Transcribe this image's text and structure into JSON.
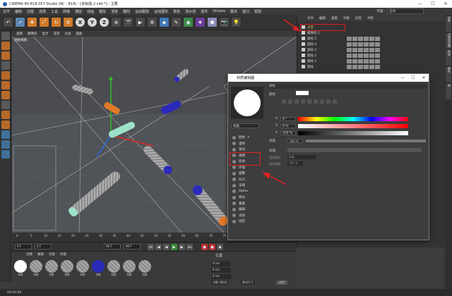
{
  "window": {
    "title": "CINEMA 4D R18.057 Studio (RC - R18) - [未标题 2.c4d *] - 主要",
    "min": "—",
    "max": "☐",
    "close": "✕"
  },
  "menubar": {
    "items": [
      "文件",
      "编辑",
      "创建",
      "选择",
      "工具",
      "网格",
      "捕捉",
      "动画",
      "模拟",
      "渲染",
      "雕刻",
      "运动跟踪",
      "运动图形",
      "角色",
      "流水线",
      "插件",
      "Octane",
      "脚本",
      "窗口",
      "帮助"
    ],
    "layout_label": "界面:",
    "layout_value": "启动"
  },
  "toolbar": {
    "buttons": [
      "undo-icon",
      "select-icon",
      "move-icon",
      "scale-icon",
      "rotate-icon",
      "recent-icon",
      "X",
      "Y",
      "Z",
      "coord-icon",
      "render-view-icon",
      "render-icon",
      "render-settings-icon",
      "cube-icon",
      "pen-icon",
      "subdivision-icon",
      "array-icon",
      "camera-icon",
      "light-icon",
      "deformer-icon"
    ]
  },
  "viewport": {
    "menu": [
      "查看",
      "摄像机",
      "显示",
      "选项",
      "过滤",
      "面板"
    ],
    "label": "透视视图"
  },
  "timeline": {
    "ticks": [
      "0",
      "5",
      "10",
      "15",
      "20",
      "25",
      "30",
      "35",
      "40",
      "45",
      "50",
      "55",
      "60",
      "65",
      "70",
      "75",
      "80",
      "85",
      "90"
    ],
    "frame_end": "0 F"
  },
  "playbar": {
    "start": "0 F",
    "current": "0 F",
    "end": "90 F",
    "end2": "90 F"
  },
  "materials": {
    "tabs": [
      "创建",
      "编辑",
      "功能",
      "纹理"
    ],
    "items": [
      "材质",
      "材质",
      "材质",
      "材质",
      "材质",
      "材质",
      "材质",
      "材质",
      "材质"
    ]
  },
  "coords": {
    "tabs": [
      "位置",
      "尺寸",
      "旋转"
    ],
    "rows": [
      "0 cm",
      "0 cm",
      "0 cm"
    ],
    "rows2": [
      "0 cm",
      "0 cm",
      "0 cm"
    ],
    "rows3": [
      "0 °",
      "0 °",
      "0 °"
    ],
    "mode": "对象 (相对)",
    "size_mode": "绝对尺寸",
    "apply": "应用"
  },
  "object_manager": {
    "menu": [
      "文件",
      "编辑",
      "查看",
      "对象",
      "标签",
      "书签"
    ],
    "rows": [
      "天空",
      "摄像机.1",
      "圆柱.5",
      "圆柱.4",
      "圆柱.3",
      "圆柱.2",
      "圆柱.1",
      "圆柱"
    ]
  },
  "dialog": {
    "title": "材质编辑器",
    "material_name": "材质",
    "section_title": "颜色",
    "color_label": "颜色",
    "channels": [
      "颜色",
      "漫射",
      "发光",
      "透明",
      "反射",
      "环境",
      "烟雾",
      "凹凸",
      "法线",
      "Alpha",
      "辉光",
      "置换",
      "编辑",
      "光照",
      "指定"
    ],
    "h_label": "H",
    "h_value": "0 °",
    "s_label": "S",
    "s_value": "0 %",
    "v_label": "V",
    "v_value": "100 %",
    "brightness_label": "亮度",
    "brightness_value": "100 %",
    "texture_label": "纹理",
    "mix_mode_label": "混合模式",
    "mix_mode_value": "标准",
    "mix_strength_label": "混合强度",
    "mix_strength_value": "100 %"
  },
  "status": {
    "time": "00:00:00"
  },
  "right_tabs": [
    "对象",
    "内容浏览器",
    "构造",
    "属性",
    "层"
  ]
}
